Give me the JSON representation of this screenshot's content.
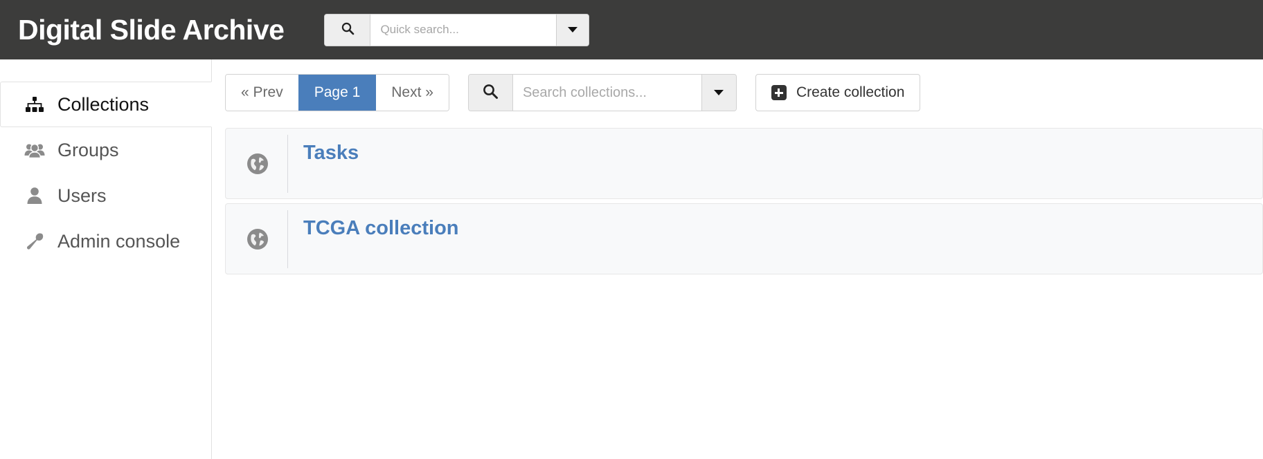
{
  "header": {
    "brand": "Digital Slide Archive",
    "background_color": "#3c3c3b",
    "quick_search": {
      "placeholder": "Quick search...",
      "value": "",
      "search_icon": "search-icon",
      "caret_icon": "chevron-down-icon"
    }
  },
  "sidebar": {
    "items": [
      {
        "label": "Collections",
        "icon": "sitemap-icon",
        "active": true
      },
      {
        "label": "Groups",
        "icon": "users-group-icon",
        "active": false
      },
      {
        "label": "Users",
        "icon": "user-icon",
        "active": false
      },
      {
        "label": "Admin console",
        "icon": "wrench-icon",
        "active": false
      }
    ]
  },
  "toolbar": {
    "pagination": {
      "prev_label": "« Prev",
      "current_label": "Page 1",
      "next_label": "Next »",
      "current_page": 1,
      "active_color": "#4a7ebb"
    },
    "collection_search": {
      "placeholder": "Search collections...",
      "value": "",
      "search_icon": "search-icon",
      "caret_icon": "chevron-down-icon"
    },
    "create_collection": {
      "label": "Create collection",
      "icon": "plus-square-icon"
    }
  },
  "collections": {
    "link_color": "#4a7ebb",
    "items": [
      {
        "name": "Tasks",
        "icon": "globe-icon"
      },
      {
        "name": "TCGA collection",
        "icon": "globe-icon"
      }
    ]
  }
}
